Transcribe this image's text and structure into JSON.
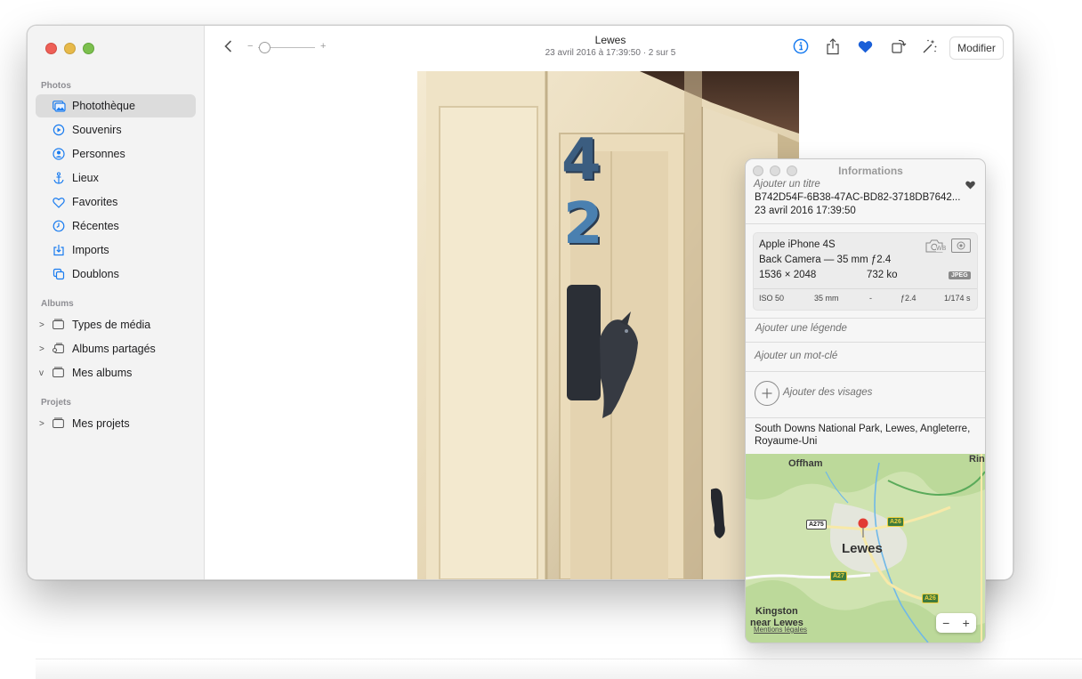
{
  "sidebar": {
    "sections": {
      "photos": "Photos",
      "albums": "Albums",
      "projects": "Projets"
    },
    "items": [
      {
        "label": "Photothèque",
        "icon": "photo-library-icon"
      },
      {
        "label": "Souvenirs",
        "icon": "memories-icon"
      },
      {
        "label": "Personnes",
        "icon": "people-icon"
      },
      {
        "label": "Lieux",
        "icon": "places-anchor-icon"
      },
      {
        "label": "Favorites",
        "icon": "heart-icon"
      },
      {
        "label": "Récentes",
        "icon": "clock-icon"
      },
      {
        "label": "Imports",
        "icon": "import-icon"
      },
      {
        "label": "Doublons",
        "icon": "duplicates-icon"
      }
    ],
    "albums": [
      {
        "label": "Types de média",
        "chevron": ">"
      },
      {
        "label": "Albums partagés",
        "chevron": ">"
      },
      {
        "label": "Mes albums",
        "chevron": "v"
      }
    ],
    "projects": [
      {
        "label": "Mes projets",
        "chevron": ">"
      }
    ]
  },
  "toolbar": {
    "title": "Lewes",
    "subtitle": "23 avril 2016 à 17:39:50  ·  2 sur 5",
    "zoom_minus": "−",
    "zoom_plus": "+",
    "edit_label": "Modifier",
    "favorite_color": "#1a5fd8",
    "accent_color": "#1a7cf0"
  },
  "photo": {
    "numbers": [
      "4",
      "2"
    ]
  },
  "info": {
    "title": "Informations",
    "add_title": "Ajouter un titre",
    "filename": "B742D54F-6B38-47AC-BD82-3718DB7642...",
    "datetime": "23 avril 2016   17:39:50",
    "camera": {
      "model": "Apple iPhone 4S",
      "lens": "Back Camera — 35 mm ƒ2.4",
      "resolution": "1536 × 2048",
      "size": "732 ko",
      "format": "JPEG",
      "wb": "WB",
      "specs": [
        "ISO 50",
        "35 mm",
        "-",
        "ƒ2.4",
        "1/174 s"
      ]
    },
    "add_caption": "Ajouter une légende",
    "add_keyword": "Ajouter un mot-clé",
    "add_faces": "Ajouter des visages",
    "location_line1": "South Downs National Park, Lewes, Angleterre,",
    "location_line2": "Royaume-Uni",
    "map": {
      "labels": {
        "offham": "Offham",
        "rin": "Rin",
        "lewes": "Lewes",
        "kingston1": "Kingston",
        "kingston2": "near Lewes",
        "legal": "Mentions légales"
      },
      "roads": [
        "A275",
        "A26",
        "A27",
        "A26"
      ],
      "zoom_out": "−",
      "zoom_in": "+"
    }
  }
}
